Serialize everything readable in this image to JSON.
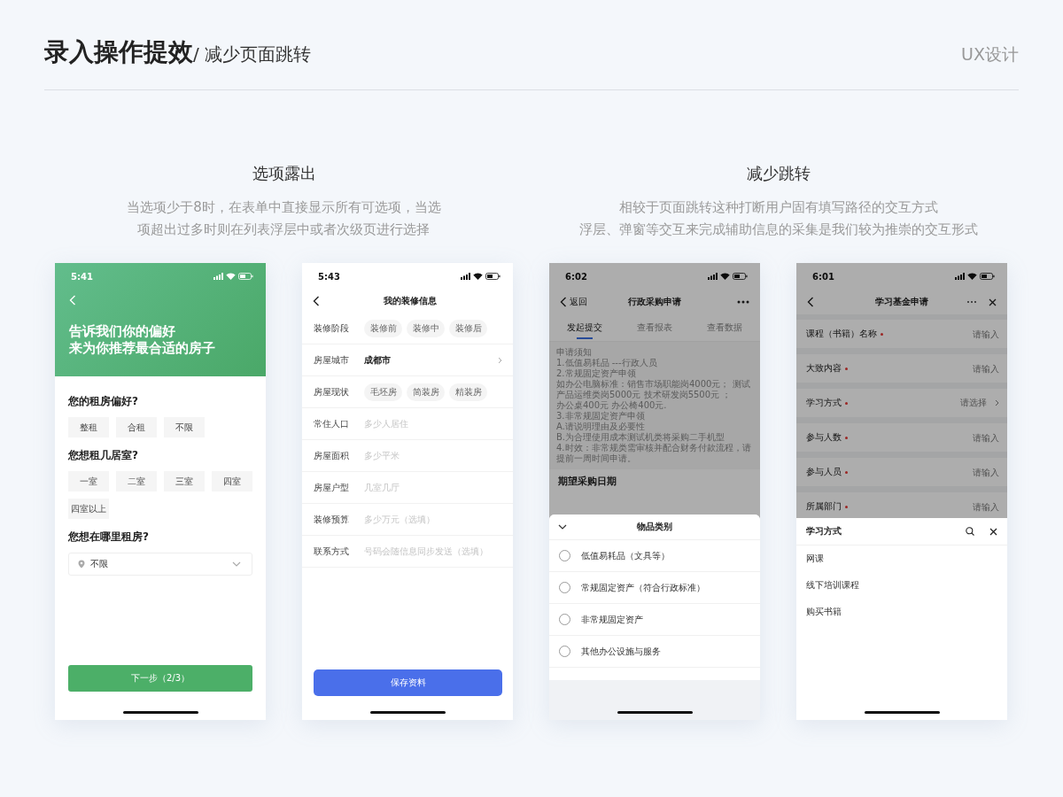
{
  "header": {
    "title": "录入操作提效",
    "subtitle": "/ 减少页面跳转",
    "tag": "UX设计"
  },
  "sections": [
    {
      "title": "选项露出",
      "description": [
        "当选项少于8时，在表单中直接显示所有可选项，当选",
        "项超出过多时则在列表浮层中或者次级页进行选择"
      ],
      "phones": [
        {
          "kind": "preference",
          "time": "5:41",
          "heading": [
            "告诉我们你的偏好",
            "来为你推荐最合适的房子"
          ],
          "questions": [
            {
              "label": "您的租房偏好?",
              "options": [
                {
                  "label": "整租",
                  "selected": false
                },
                {
                  "label": "合租",
                  "selected": false
                },
                {
                  "label": "不限",
                  "selected": false
                }
              ]
            },
            {
              "label": "您想租几居室?",
              "options": [
                {
                  "label": "一室",
                  "selected": false
                },
                {
                  "label": "二室",
                  "selected": false
                },
                {
                  "label": "三室",
                  "selected": false
                },
                {
                  "label": "四室",
                  "selected": false
                },
                {
                  "label": "四室以上",
                  "selected": false
                }
              ]
            }
          ],
          "location": {
            "label": "您想在哪里租房?",
            "value": "不限"
          },
          "button": "下一步（2/3）"
        },
        {
          "kind": "form",
          "time": "5:43",
          "title": "我的装修信息",
          "rows": [
            {
              "kind": "chips",
              "label": "装修阶段",
              "options": [
                {
                  "label": "装修前",
                  "selected": false
                },
                {
                  "label": "装修中",
                  "selected": false
                },
                {
                  "label": "装修后",
                  "selected": false
                }
              ]
            },
            {
              "kind": "link",
              "label": "房屋城市",
              "value": "成都市"
            },
            {
              "kind": "chips",
              "label": "房屋现状",
              "options": [
                {
                  "label": "毛坯房",
                  "selected": false
                },
                {
                  "label": "简装房",
                  "selected": false
                },
                {
                  "label": "精装房",
                  "selected": false
                }
              ]
            },
            {
              "kind": "input",
              "label": "常住人口",
              "placeholder": "多少人居住"
            },
            {
              "kind": "input",
              "label": "房屋面积",
              "placeholder": "多少平米"
            },
            {
              "kind": "input",
              "label": "房屋户型",
              "placeholder": "几室几厅"
            },
            {
              "kind": "input",
              "label": "装修预算",
              "placeholder": "多少万元（选填）"
            },
            {
              "kind": "input",
              "label": "联系方式",
              "placeholder": "号码会随信息同步发送（选填）"
            }
          ],
          "button": "保存资料"
        }
      ]
    },
    {
      "title": "减少跳转",
      "description": [
        "相较于页面跳转这种打断用户固有填写路径的交互方式",
        "浮层、弹窗等交互来完成辅助信息的采集是我们较为推崇的交互形式"
      ],
      "phones": [
        {
          "kind": "sheet_radio",
          "time": "6:02",
          "back": "返回",
          "title": "行政采购申请",
          "tabs": [
            {
              "label": "发起提交",
              "selected": true
            },
            {
              "label": "查看报表",
              "selected": false
            },
            {
              "label": "查看数据",
              "selected": false
            }
          ],
          "notice": [
            "申请须知",
            "1.低值易耗品 ---行政人员",
            "2.常规固定资产申领",
            "如办公电脑标准：销售市场职能岗4000元； 测试产品运维类岗5000元 技术研发岗5500元 ；",
            "办公桌400元 办公椅400元.",
            "3.非常规固定资产申领",
            "A.请说明理由及必要性",
            "B.为合理使用成本测试机类将采购二手机型",
            "4.时效：非常规类需审核并配合财务付款流程，请提前一周时间申请。"
          ],
          "field_label": "期望采购日期",
          "sheet": {
            "title": "物品类别",
            "options": [
              {
                "label": "低值易耗品（文具等）",
                "checked": false
              },
              {
                "label": "常规固定资产（符合行政标准）",
                "checked": false
              },
              {
                "label": "非常规固定资产",
                "checked": false
              },
              {
                "label": "其他办公设施与服务",
                "checked": false
              }
            ]
          }
        },
        {
          "kind": "sheet_list",
          "time": "6:01",
          "title": "学习基金申请",
          "fields": [
            {
              "kind": "input",
              "label": "课程（书籍）名称",
              "required": true,
              "placeholder": "请输入"
            },
            {
              "kind": "input",
              "label": "大致内容",
              "required": true,
              "placeholder": "请输入"
            },
            {
              "kind": "select",
              "label": "学习方式",
              "required": true,
              "placeholder": "请选择"
            },
            {
              "kind": "input",
              "label": "参与人数",
              "required": true,
              "placeholder": "请输入"
            },
            {
              "kind": "input",
              "label": "参与人员",
              "required": true,
              "placeholder": "请输入"
            },
            {
              "kind": "input",
              "label": "所属部门",
              "required": true,
              "placeholder": "请输入"
            }
          ],
          "sheet": {
            "title": "学习方式",
            "options": [
              "网课",
              "线下培训课程",
              "购买书籍"
            ]
          }
        }
      ]
    }
  ]
}
